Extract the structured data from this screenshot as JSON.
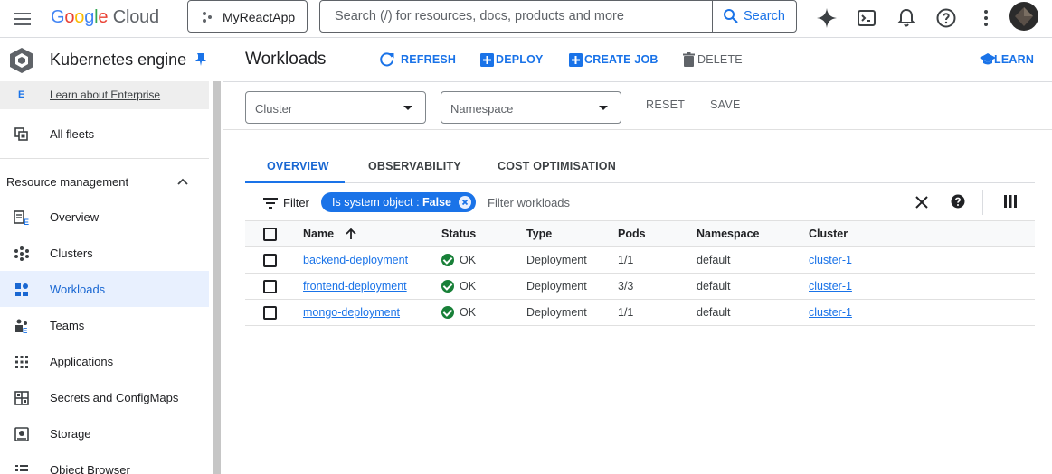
{
  "topbar": {
    "logo": {
      "g": "G",
      "o1": "o",
      "o2": "o",
      "g2": "g",
      "l": "l",
      "e": "e",
      "cloud": " Cloud"
    },
    "project": "MyReactApp",
    "search_placeholder": "Search (/) for resources, docs, products and more",
    "search_button": "Search"
  },
  "sidebar": {
    "product_title": "Kubernetes engine",
    "enterprise_letter": "E",
    "enterprise_link": "Learn about Enterprise",
    "all_fleets": "All fleets",
    "section_title": "Resource management",
    "items": [
      {
        "label": "Overview",
        "icon": "overview-icon"
      },
      {
        "label": "Clusters",
        "icon": "clusters-icon"
      },
      {
        "label": "Workloads",
        "icon": "workloads-icon",
        "active": true
      },
      {
        "label": "Teams",
        "icon": "teams-icon"
      },
      {
        "label": "Applications",
        "icon": "applications-icon"
      },
      {
        "label": "Secrets and ConfigMaps",
        "icon": "secrets-icon"
      },
      {
        "label": "Storage",
        "icon": "storage-icon"
      },
      {
        "label": "Object Browser",
        "icon": "object-browser-icon"
      }
    ]
  },
  "header": {
    "title": "Workloads",
    "refresh": "REFRESH",
    "deploy": "DEPLOY",
    "create_job": "CREATE JOB",
    "delete": "DELETE",
    "learn": "LEARN"
  },
  "filters": {
    "cluster": "Cluster",
    "namespace": "Namespace",
    "reset": "RESET",
    "save": "SAVE"
  },
  "tabs": [
    "OVERVIEW",
    "OBSERVABILITY",
    "COST OPTIMISATION"
  ],
  "filterbar": {
    "label": "Filter",
    "chip_key": "Is system object",
    "chip_sep": " : ",
    "chip_value": "False",
    "placeholder": "Filter workloads"
  },
  "table": {
    "columns": [
      "Name",
      "Status",
      "Type",
      "Pods",
      "Namespace",
      "Cluster"
    ],
    "rows": [
      {
        "name": "backend-deployment",
        "status": "OK",
        "type": "Deployment",
        "pods": "1/1",
        "namespace": "default",
        "cluster": "cluster-1"
      },
      {
        "name": "frontend-deployment",
        "status": "OK",
        "type": "Deployment",
        "pods": "3/3",
        "namespace": "default",
        "cluster": "cluster-1"
      },
      {
        "name": "mongo-deployment",
        "status": "OK",
        "type": "Deployment",
        "pods": "1/1",
        "namespace": "default",
        "cluster": "cluster-1"
      }
    ]
  },
  "colors": {
    "accent": "#1a73e8",
    "ok": "#188038",
    "active_bg": "#e8f0fe"
  }
}
